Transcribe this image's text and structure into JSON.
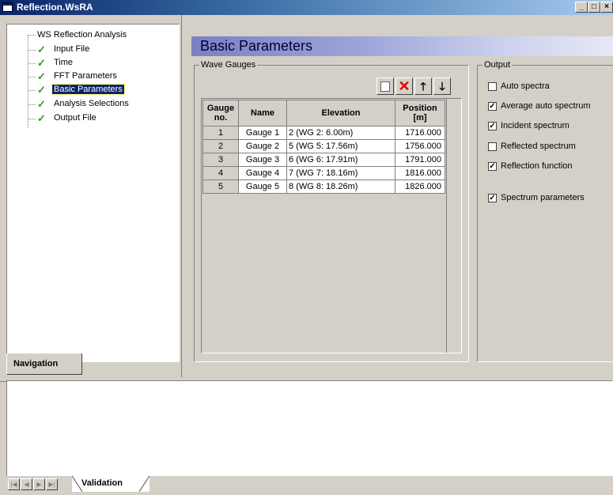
{
  "window": {
    "title": "Reflection.WsRA",
    "buttons": [
      "_",
      "□",
      "×"
    ]
  },
  "navigation": {
    "root": "WS Reflection Analysis",
    "items": [
      {
        "label": "Input File",
        "checked": true
      },
      {
        "label": "Time",
        "checked": true
      },
      {
        "label": "FFT Parameters",
        "checked": true
      },
      {
        "label": "Basic Parameters",
        "checked": true,
        "selected": true
      },
      {
        "label": "Analysis Selections",
        "checked": true
      },
      {
        "label": "Output File",
        "checked": true
      }
    ],
    "tab": "Navigation"
  },
  "main": {
    "heading": "Basic Parameters",
    "wave_gauges": {
      "legend": "Wave Gauges",
      "toolbar": [
        "new-icon",
        "delete-icon",
        "move-up-icon",
        "move-down-icon"
      ],
      "columns": [
        "Gauge no.",
        "Name",
        "Elevation",
        "Position [m]"
      ],
      "rows": [
        [
          "1",
          "Gauge 1",
          "2 (WG 2:  6.00m)",
          "1716.000"
        ],
        [
          "2",
          "Gauge 2",
          "5 (WG 5: 17.56m)",
          "1756.000"
        ],
        [
          "3",
          "Gauge 3",
          "6 (WG 6: 17.91m)",
          "1791.000"
        ],
        [
          "4",
          "Gauge 4",
          "7 (WG 7: 18.16m)",
          "1816.000"
        ],
        [
          "5",
          "Gauge 5",
          "8 (WG 8: 18.26m)",
          "1826.000"
        ]
      ]
    },
    "output": {
      "legend": "Output",
      "options": [
        {
          "label": "Auto spectra",
          "checked": false
        },
        {
          "label": "Average auto spectrum",
          "checked": true
        },
        {
          "label": "Incident spectrum",
          "checked": true
        },
        {
          "label": "Reflected spectrum",
          "checked": false
        },
        {
          "label": "Reflection function",
          "checked": true
        },
        {
          "label": "Spectrum parameters",
          "checked": true
        }
      ]
    }
  },
  "validation": {
    "tab": "Validation"
  },
  "colors": {
    "accent": "#0a246a",
    "check": "#2e9e1e",
    "delete": "#e00000"
  }
}
